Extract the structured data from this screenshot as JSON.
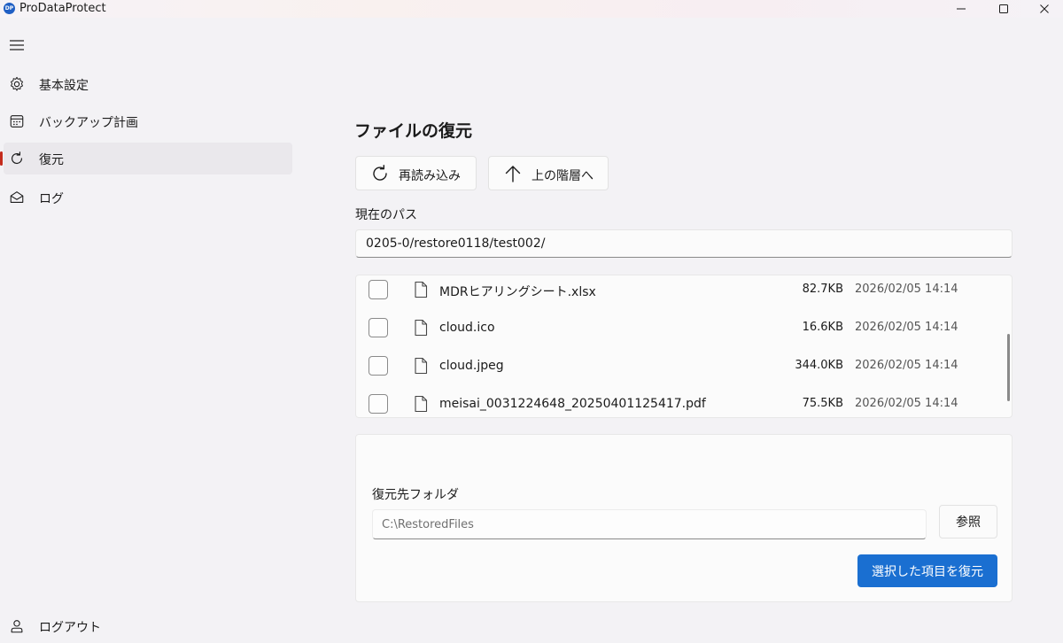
{
  "window": {
    "logo_text": "DP",
    "title": "ProDataProtect"
  },
  "sidebar": {
    "items": [
      {
        "label": "基本設定",
        "icon": "gear-icon"
      },
      {
        "label": "バックアップ計画",
        "icon": "calendar-icon"
      },
      {
        "label": "復元",
        "icon": "refresh-icon",
        "active": true
      },
      {
        "label": "ログ",
        "icon": "mail-open-icon"
      }
    ],
    "logout_label": "ログアウト"
  },
  "main": {
    "title": "ファイルの復元",
    "reload_label": "再読み込み",
    "up_label": "上の階層へ",
    "path_label": "現在のパス",
    "current_path": "0205-0/restore0118/test002/",
    "files": [
      {
        "name": "MDRヒアリングシート.xlsx",
        "size": "82.7KB",
        "date": "2026/02/05 14:14"
      },
      {
        "name": "cloud.ico",
        "size": "16.6KB",
        "date": "2026/02/05 14:14"
      },
      {
        "name": "cloud.jpeg",
        "size": "344.0KB",
        "date": "2026/02/05 14:14"
      },
      {
        "name": "meisai_0031224648_20250401125417.pdf",
        "size": "75.5KB",
        "date": "2026/02/05 14:14"
      }
    ],
    "restore": {
      "dest_label": "復元先フォルダ",
      "dest_placeholder": "C:\\RestoredFiles",
      "browse_label": "参照",
      "restore_button": "選択した項目を復元"
    }
  },
  "colors": {
    "accent": "#1a6fd1",
    "active_indicator": "#c42b1c"
  }
}
